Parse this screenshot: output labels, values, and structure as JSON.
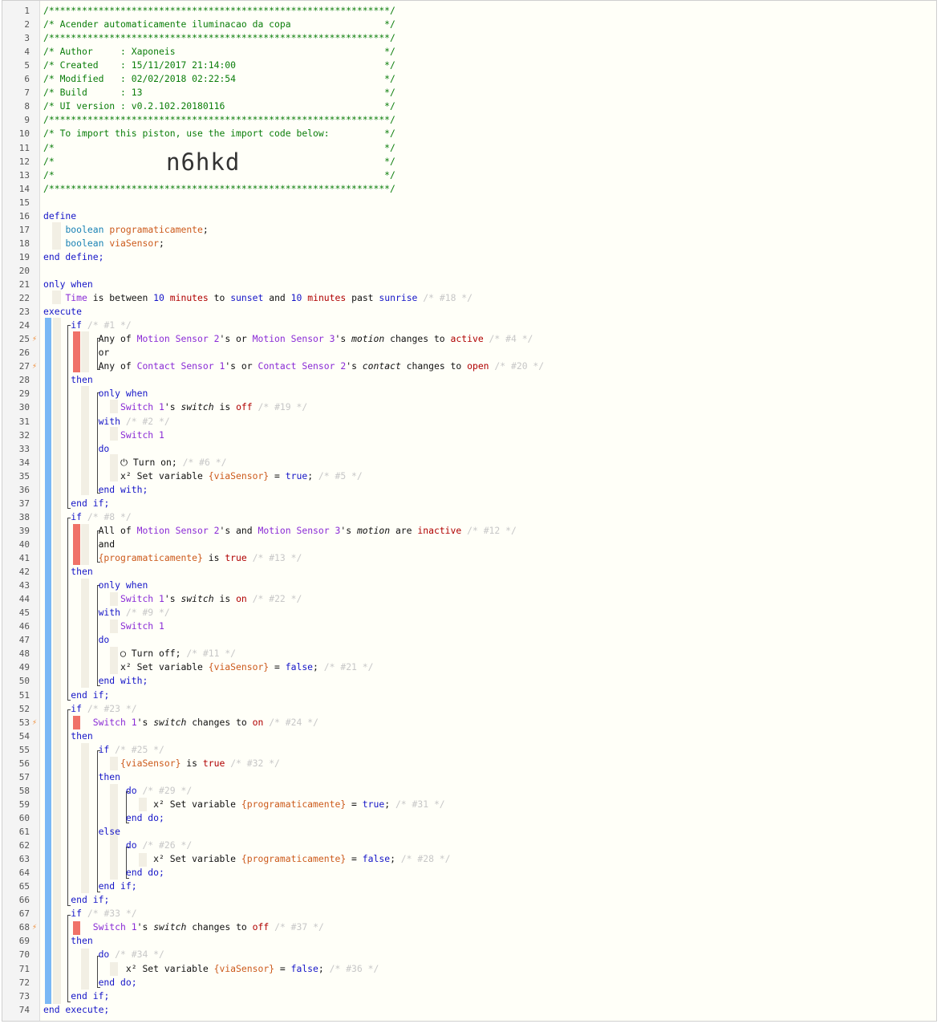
{
  "import_code": "n6hkd",
  "line_numbers": [
    "1",
    "2",
    "3",
    "4",
    "5",
    "6",
    "7",
    "8",
    "9",
    "10",
    "11",
    "12",
    "13",
    "14",
    "15",
    "16",
    "17",
    "18",
    "19",
    "20",
    "21",
    "22",
    "23",
    "24",
    "25",
    "26",
    "27",
    "28",
    "29",
    "30",
    "31",
    "32",
    "33",
    "34",
    "35",
    "36",
    "37",
    "38",
    "39",
    "40",
    "41",
    "42",
    "43",
    "44",
    "45",
    "46",
    "47",
    "48",
    "49",
    "50",
    "51",
    "52",
    "53",
    "54",
    "55",
    "56",
    "57",
    "58",
    "59",
    "60",
    "61",
    "62",
    "63",
    "64",
    "65",
    "66",
    "67",
    "68",
    "69",
    "70",
    "71",
    "72",
    "73",
    "74"
  ],
  "trigger_lines": [
    25,
    27,
    53,
    68
  ],
  "icons": {
    "trigger": "lightning-bolt-icon",
    "power": "power-icon",
    "variable": "x-squared-icon"
  },
  "colors": {
    "accent_blue": "#7ab8f5",
    "condition_red": "#f07268",
    "comment_green": "#0a7d0a",
    "keyword_blue": "#1515c8"
  },
  "lines": [
    [
      [
        "c",
        "/**************************************************************/"
      ]
    ],
    [
      [
        "c",
        "/* Acender automaticamente iluminacao da copa                 */"
      ]
    ],
    [
      [
        "c",
        "/**************************************************************/"
      ]
    ],
    [
      [
        "c",
        "/* Author     : Xaponeis                                      */"
      ]
    ],
    [
      [
        "c",
        "/* Created    : 15/11/2017 21:14:00                           */"
      ]
    ],
    [
      [
        "c",
        "/* Modified   : 02/02/2018 02:22:54                           */"
      ]
    ],
    [
      [
        "c",
        "/* Build      : 13                                            */"
      ]
    ],
    [
      [
        "c",
        "/* UI version : v0.2.102.20180116                             */"
      ]
    ],
    [
      [
        "c",
        "/**************************************************************/"
      ]
    ],
    [
      [
        "c",
        "/* To import this piston, use the import code below:          */"
      ]
    ],
    [
      [
        "c",
        "/*                                                            */"
      ]
    ],
    [
      [
        "c",
        "/*                                                            */"
      ]
    ],
    [
      [
        "c",
        "/*                                                            */"
      ]
    ],
    [
      [
        "c",
        "/**************************************************************/"
      ]
    ],
    [],
    [
      [
        "k",
        "define"
      ]
    ],
    [
      [
        "",
        "    "
      ],
      [
        "ty",
        "boolean"
      ],
      [
        "",
        " "
      ],
      [
        "var",
        "programaticamente"
      ],
      [
        "",
        ";"
      ]
    ],
    [
      [
        "",
        "    "
      ],
      [
        "ty",
        "boolean"
      ],
      [
        "",
        " "
      ],
      [
        "var",
        "viaSensor"
      ],
      [
        "",
        ";"
      ]
    ],
    [
      [
        "k",
        "end define;"
      ]
    ],
    [],
    [
      [
        "k",
        "only when"
      ]
    ],
    [
      [
        "",
        "    "
      ],
      [
        "dev",
        "Time"
      ],
      [
        "",
        " is between "
      ],
      [
        "num",
        "10"
      ],
      [
        "",
        " "
      ],
      [
        "val",
        "minutes"
      ],
      [
        "",
        " to "
      ],
      [
        "k",
        "sunset"
      ],
      [
        "",
        " and "
      ],
      [
        "num",
        "10"
      ],
      [
        "",
        " "
      ],
      [
        "val",
        "minutes"
      ],
      [
        "",
        " past "
      ],
      [
        "k",
        "sunrise"
      ],
      [
        "",
        " "
      ],
      [
        "cm",
        "/* #18 */"
      ]
    ],
    [
      [
        "k",
        "execute"
      ]
    ],
    [
      [
        "",
        "     "
      ],
      [
        "k",
        "if"
      ],
      [
        "",
        " "
      ],
      [
        "cm",
        "/* #1 */"
      ]
    ],
    [
      [
        "",
        "          Any of "
      ],
      [
        "dev",
        "Motion Sensor 2"
      ],
      [
        "",
        "'s or "
      ],
      [
        "dev",
        "Motion Sensor 3"
      ],
      [
        "",
        "'s "
      ],
      [
        "it",
        "motion"
      ],
      [
        "",
        " changes to "
      ],
      [
        "val",
        "active"
      ],
      [
        "",
        " "
      ],
      [
        "cm",
        "/* #4 */"
      ]
    ],
    [
      [
        "",
        "          or"
      ]
    ],
    [
      [
        "",
        "          Any of "
      ],
      [
        "dev",
        "Contact Sensor 1"
      ],
      [
        "",
        "'s or "
      ],
      [
        "dev",
        "Contact Sensor 2"
      ],
      [
        "",
        "'s "
      ],
      [
        "it",
        "contact"
      ],
      [
        "",
        " changes to "
      ],
      [
        "val",
        "open"
      ],
      [
        "",
        " "
      ],
      [
        "cm",
        "/* #20 */"
      ]
    ],
    [
      [
        "",
        "     "
      ],
      [
        "k",
        "then"
      ]
    ],
    [
      [
        "",
        "          "
      ],
      [
        "k",
        "only when"
      ]
    ],
    [
      [
        "",
        "              "
      ],
      [
        "dev",
        "Switch 1"
      ],
      [
        "",
        "'s "
      ],
      [
        "it",
        "switch"
      ],
      [
        "",
        " is "
      ],
      [
        "val",
        "off"
      ],
      [
        "",
        " "
      ],
      [
        "cm",
        "/* #19 */"
      ]
    ],
    [
      [
        "",
        "          "
      ],
      [
        "k",
        "with"
      ],
      [
        "",
        " "
      ],
      [
        "cm",
        "/* #2 */"
      ]
    ],
    [
      [
        "",
        "              "
      ],
      [
        "dev",
        "Switch 1"
      ]
    ],
    [
      [
        "",
        "          "
      ],
      [
        "k",
        "do"
      ]
    ],
    [
      [
        "",
        "              ⏻ Turn on; "
      ],
      [
        "cm",
        "/* #6 */"
      ]
    ],
    [
      [
        "",
        "              x² Set variable "
      ],
      [
        "var",
        "{viaSensor}"
      ],
      [
        "",
        " = "
      ],
      [
        "k",
        "true"
      ],
      [
        "",
        "; "
      ],
      [
        "cm",
        "/* #5 */"
      ]
    ],
    [
      [
        "",
        "          "
      ],
      [
        "k",
        "end with;"
      ]
    ],
    [
      [
        "",
        "     "
      ],
      [
        "k",
        "end if;"
      ]
    ],
    [
      [
        "",
        "     "
      ],
      [
        "k",
        "if"
      ],
      [
        "",
        " "
      ],
      [
        "cm",
        "/* #8 */"
      ]
    ],
    [
      [
        "",
        "          All of "
      ],
      [
        "dev",
        "Motion Sensor 2"
      ],
      [
        "",
        "'s and "
      ],
      [
        "dev",
        "Motion Sensor 3"
      ],
      [
        "",
        "'s "
      ],
      [
        "it",
        "motion"
      ],
      [
        "",
        " are "
      ],
      [
        "val",
        "inactive"
      ],
      [
        "",
        " "
      ],
      [
        "cm",
        "/* #12 */"
      ]
    ],
    [
      [
        "",
        "          and"
      ]
    ],
    [
      [
        "",
        "          "
      ],
      [
        "var",
        "{programaticamente}"
      ],
      [
        "",
        " is "
      ],
      [
        "val",
        "true"
      ],
      [
        "",
        " "
      ],
      [
        "cm",
        "/* #13 */"
      ]
    ],
    [
      [
        "",
        "     "
      ],
      [
        "k",
        "then"
      ]
    ],
    [
      [
        "",
        "          "
      ],
      [
        "k",
        "only when"
      ]
    ],
    [
      [
        "",
        "              "
      ],
      [
        "dev",
        "Switch 1"
      ],
      [
        "",
        "'s "
      ],
      [
        "it",
        "switch"
      ],
      [
        "",
        " is "
      ],
      [
        "val",
        "on"
      ],
      [
        "",
        " "
      ],
      [
        "cm",
        "/* #22 */"
      ]
    ],
    [
      [
        "",
        "          "
      ],
      [
        "k",
        "with"
      ],
      [
        "",
        " "
      ],
      [
        "cm",
        "/* #9 */"
      ]
    ],
    [
      [
        "",
        "              "
      ],
      [
        "dev",
        "Switch 1"
      ]
    ],
    [
      [
        "",
        "          "
      ],
      [
        "k",
        "do"
      ]
    ],
    [
      [
        "",
        "              ◯ Turn off; "
      ],
      [
        "cm",
        "/* #11 */"
      ]
    ],
    [
      [
        "",
        "              x² Set variable "
      ],
      [
        "var",
        "{viaSensor}"
      ],
      [
        "",
        " = "
      ],
      [
        "k",
        "false"
      ],
      [
        "",
        "; "
      ],
      [
        "cm",
        "/* #21 */"
      ]
    ],
    [
      [
        "",
        "          "
      ],
      [
        "k",
        "end with;"
      ]
    ],
    [
      [
        "",
        "     "
      ],
      [
        "k",
        "end if;"
      ]
    ],
    [
      [
        "",
        "     "
      ],
      [
        "k",
        "if"
      ],
      [
        "",
        " "
      ],
      [
        "cm",
        "/* #23 */"
      ]
    ],
    [
      [
        "",
        "         "
      ],
      [
        "dev",
        "Switch 1"
      ],
      [
        "",
        "'s "
      ],
      [
        "it",
        "switch"
      ],
      [
        "",
        " changes to "
      ],
      [
        "val",
        "on"
      ],
      [
        "",
        " "
      ],
      [
        "cm",
        "/* #24 */"
      ]
    ],
    [
      [
        "",
        "     "
      ],
      [
        "k",
        "then"
      ]
    ],
    [
      [
        "",
        "          "
      ],
      [
        "k",
        "if"
      ],
      [
        "",
        " "
      ],
      [
        "cm",
        "/* #25 */"
      ]
    ],
    [
      [
        "",
        "              "
      ],
      [
        "var",
        "{viaSensor}"
      ],
      [
        "",
        " is "
      ],
      [
        "val",
        "true"
      ],
      [
        "",
        " "
      ],
      [
        "cm",
        "/* #32 */"
      ]
    ],
    [
      [
        "",
        "          "
      ],
      [
        "k",
        "then"
      ]
    ],
    [
      [
        "",
        "               "
      ],
      [
        "k",
        "do"
      ],
      [
        "",
        " "
      ],
      [
        "cm",
        "/* #29 */"
      ]
    ],
    [
      [
        "",
        "                    x² Set variable "
      ],
      [
        "var",
        "{programaticamente}"
      ],
      [
        "",
        " = "
      ],
      [
        "k",
        "true"
      ],
      [
        "",
        "; "
      ],
      [
        "cm",
        "/* #31 */"
      ]
    ],
    [
      [
        "",
        "               "
      ],
      [
        "k",
        "end do;"
      ]
    ],
    [
      [
        "",
        "          "
      ],
      [
        "k",
        "else"
      ]
    ],
    [
      [
        "",
        "               "
      ],
      [
        "k",
        "do"
      ],
      [
        "",
        " "
      ],
      [
        "cm",
        "/* #26 */"
      ]
    ],
    [
      [
        "",
        "                    x² Set variable "
      ],
      [
        "var",
        "{programaticamente}"
      ],
      [
        "",
        " = "
      ],
      [
        "k",
        "false"
      ],
      [
        "",
        "; "
      ],
      [
        "cm",
        "/* #28 */"
      ]
    ],
    [
      [
        "",
        "               "
      ],
      [
        "k",
        "end do;"
      ]
    ],
    [
      [
        "",
        "          "
      ],
      [
        "k",
        "end if;"
      ]
    ],
    [
      [
        "",
        "     "
      ],
      [
        "k",
        "end if;"
      ]
    ],
    [
      [
        "",
        "     "
      ],
      [
        "k",
        "if"
      ],
      [
        "",
        " "
      ],
      [
        "cm",
        "/* #33 */"
      ]
    ],
    [
      [
        "",
        "         "
      ],
      [
        "dev",
        "Switch 1"
      ],
      [
        "",
        "'s "
      ],
      [
        "it",
        "switch"
      ],
      [
        "",
        " changes to "
      ],
      [
        "val",
        "off"
      ],
      [
        "",
        " "
      ],
      [
        "cm",
        "/* #37 */"
      ]
    ],
    [
      [
        "",
        "     "
      ],
      [
        "k",
        "then"
      ]
    ],
    [
      [
        "",
        "          "
      ],
      [
        "k",
        "do"
      ],
      [
        "",
        " "
      ],
      [
        "cm",
        "/* #34 */"
      ]
    ],
    [
      [
        "",
        "               x² Set variable "
      ],
      [
        "var",
        "{viaSensor}"
      ],
      [
        "",
        " = "
      ],
      [
        "k",
        "false"
      ],
      [
        "",
        "; "
      ],
      [
        "cm",
        "/* #36 */"
      ]
    ],
    [
      [
        "",
        "          "
      ],
      [
        "k",
        "end do;"
      ]
    ],
    [
      [
        "",
        "     "
      ],
      [
        "k",
        "end if;"
      ]
    ],
    [
      [
        "k",
        "end execute;"
      ]
    ]
  ]
}
